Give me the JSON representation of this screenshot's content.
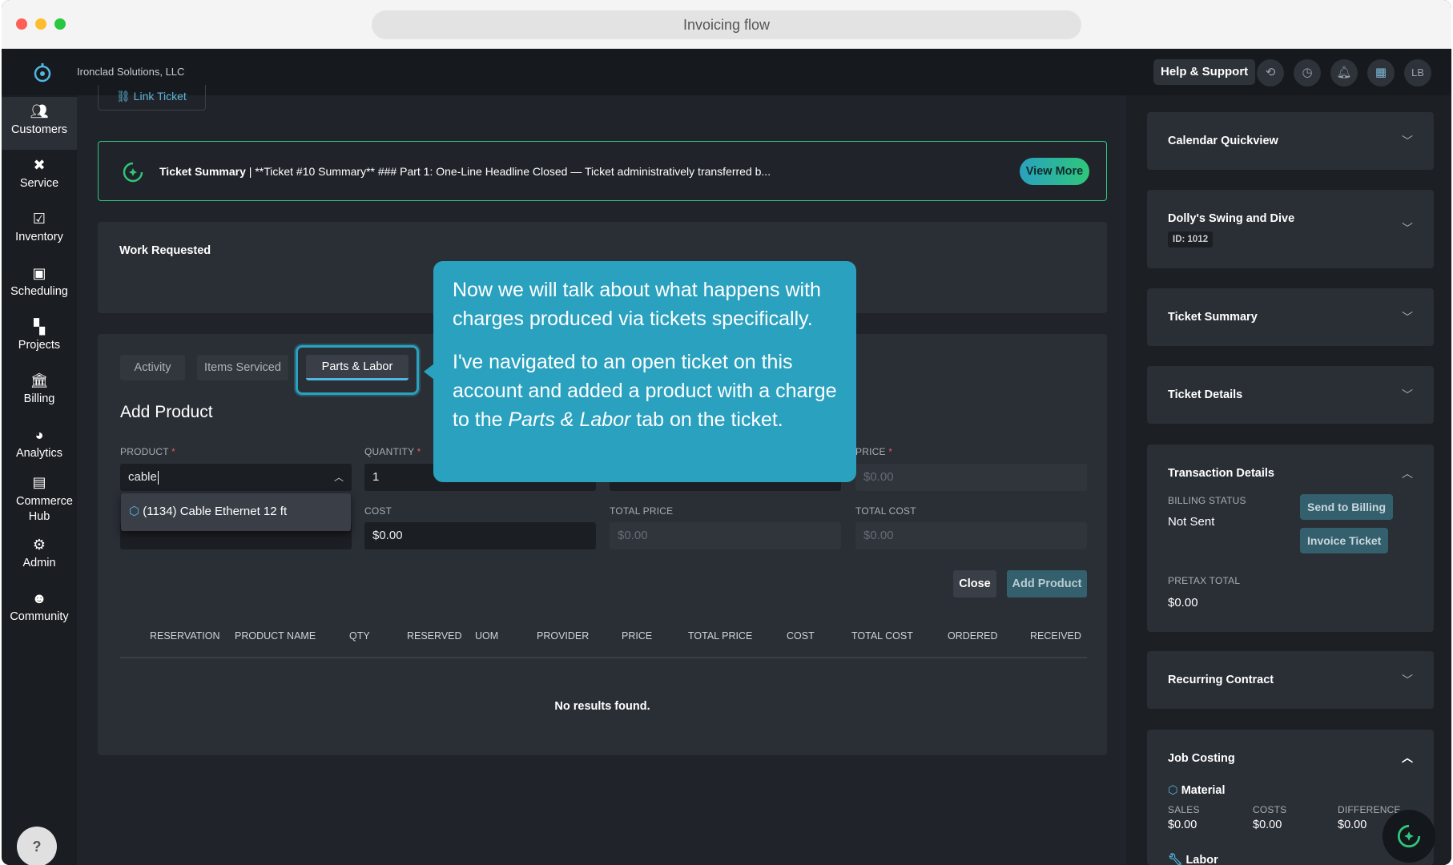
{
  "window": {
    "url_title": "Invoicing flow"
  },
  "header": {
    "company": "Ironclad Solutions, LLC",
    "help_label": "Help & Support",
    "avatar": "LB"
  },
  "sidebar": {
    "items": [
      {
        "label": "Customers",
        "icon": "customers-icon"
      },
      {
        "label": "Service",
        "icon": "service-icon"
      },
      {
        "label": "Inventory",
        "icon": "inventory-icon"
      },
      {
        "label": "Scheduling",
        "icon": "calendar-icon"
      },
      {
        "label": "Projects",
        "icon": "projects-icon"
      },
      {
        "label": "Billing",
        "icon": "bank-icon"
      },
      {
        "label": "Analytics",
        "icon": "pie-chart-icon"
      },
      {
        "label": "Commerce Hub",
        "icon": "store-icon"
      },
      {
        "label": "Admin",
        "icon": "admin-icon"
      },
      {
        "label": "Community",
        "icon": "community-icon"
      }
    ],
    "help": "?"
  },
  "main": {
    "link_ticket": "Link Ticket",
    "summary": {
      "title": "Ticket Summary",
      "text": "| **Ticket #10 Summary** ### Part 1: One-Line Headline Closed — Ticket administratively transferred b...",
      "button": "View More"
    },
    "work_requested": "Work Requested",
    "tabs": [
      "Activity",
      "Items Serviced",
      "Parts & Labor"
    ],
    "add_product": {
      "title": "Add Product",
      "product_label": "PRODUCT",
      "quantity_label": "QUANTITY",
      "price_label": "PRICE",
      "cost_label": "COST",
      "total_price_label": "TOTAL PRICE",
      "total_cost_label": "TOTAL COST",
      "required": "*",
      "product_value": "cable",
      "quantity_value": "1",
      "price_value": "$0.00",
      "cost_value": "$0.00",
      "total_price_value": "$0.00",
      "total_cost_value": "$0.00",
      "dropdown_option": "(1134) Cable Ethernet 12 ft",
      "close_button": "Close",
      "add_button": "Add Product"
    },
    "table": {
      "columns": [
        "RESERVATION",
        "PRODUCT NAME",
        "QTY",
        "RESERVED",
        "UOM",
        "PROVIDER",
        "PRICE",
        "TOTAL PRICE",
        "COST",
        "TOTAL COST",
        "ORDERED",
        "RECEIVED"
      ],
      "empty": "No results found."
    }
  },
  "tooltip": {
    "p1": "Now we will talk about what happens with charges produced via tickets specifically.",
    "p2_before": "I've navigated to an open ticket on this account and added a product with a charge to the ",
    "p2_em": "Parts & Labor",
    "p2_after": " tab on the ticket."
  },
  "right_panel": {
    "calendar": "Calendar Quickview",
    "customer_name": "Dolly's Swing and Dive",
    "customer_id": "ID: 1012",
    "ticket_summary": "Ticket Summary",
    "ticket_details": "Ticket Details",
    "transaction": {
      "title": "Transaction Details",
      "billing_status_label": "BILLING STATUS",
      "billing_status": "Not Sent",
      "send_button": "Send to Billing",
      "invoice_button": "Invoice Ticket",
      "pretax_label": "PRETAX TOTAL",
      "pretax_value": "$0.00"
    },
    "recurring": "Recurring Contract",
    "job_costing": {
      "title": "Job Costing",
      "material": "Material",
      "sales_label": "SALES",
      "costs_label": "COSTS",
      "difference_label": "DIFFERENCE",
      "sales": "$0.00",
      "costs": "$0.00",
      "difference": "$0.00",
      "labor": "Labor"
    }
  },
  "colors": {
    "accent": "#2aa1bf",
    "success": "#2ec77a"
  }
}
